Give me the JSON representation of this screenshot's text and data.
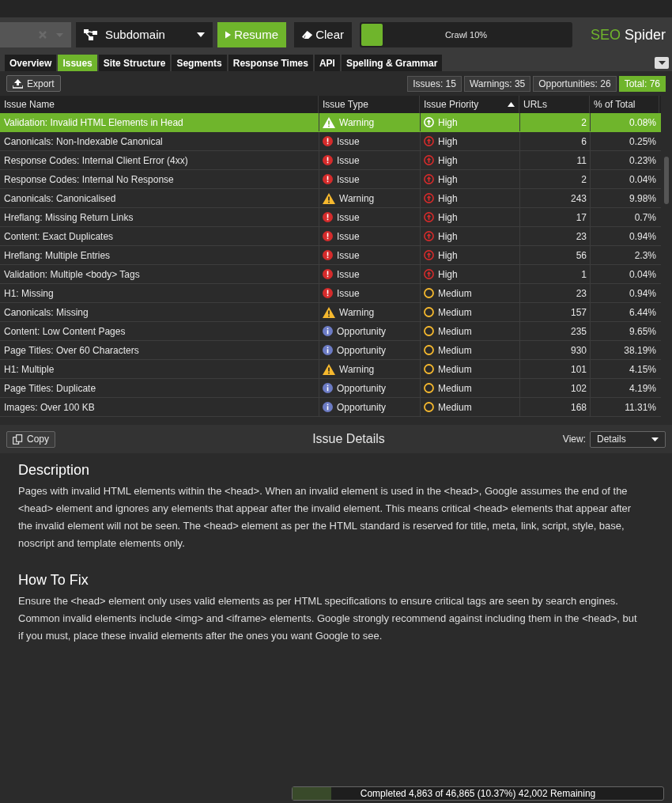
{
  "toolbar": {
    "mode": "Subdomain",
    "resume": "Resume",
    "clear": "Clear",
    "crawl": {
      "label": "Crawl 10%",
      "level": 0.1
    },
    "logo": {
      "part1": "SEO",
      "part2": "Spider"
    }
  },
  "tabs": [
    {
      "label": "Overview",
      "selected": false
    },
    {
      "label": "Issues",
      "selected": true
    },
    {
      "label": "Site Structure",
      "selected": false
    },
    {
      "label": "Segments",
      "selected": false
    },
    {
      "label": "Response Times",
      "selected": false
    },
    {
      "label": "API",
      "selected": false
    },
    {
      "label": "Spelling & Grammar",
      "selected": false
    }
  ],
  "export": "Export",
  "counts": [
    {
      "label": "Issues: 15",
      "selected": false
    },
    {
      "label": "Warnings: 35",
      "selected": false
    },
    {
      "label": "Opportunities: 26",
      "selected": false
    },
    {
      "label": "Total: 76",
      "selected": true
    }
  ],
  "table": {
    "columns": [
      "Issue Name",
      "Issue Type",
      "Issue Priority",
      "URLs",
      "% of Total"
    ],
    "rows": [
      {
        "name": "Validation: Invalid HTML Elements in Head",
        "type": {
          "label": "Warning",
          "kind": "warning"
        },
        "priority": {
          "label": "High",
          "kind": "high"
        },
        "urls": "2",
        "pct": "0.08%",
        "selected": true
      },
      {
        "name": "Canonicals: Non-Indexable Canonical",
        "type": {
          "label": "Issue",
          "kind": "issue"
        },
        "priority": {
          "label": "High",
          "kind": "high"
        },
        "urls": "6",
        "pct": "0.25%",
        "selected": false
      },
      {
        "name": "Response Codes: Internal Client Error (4xx)",
        "type": {
          "label": "Issue",
          "kind": "issue"
        },
        "priority": {
          "label": "High",
          "kind": "high"
        },
        "urls": "11",
        "pct": "0.23%",
        "selected": false
      },
      {
        "name": "Response Codes: Internal No Response",
        "type": {
          "label": "Issue",
          "kind": "issue"
        },
        "priority": {
          "label": "High",
          "kind": "high"
        },
        "urls": "2",
        "pct": "0.04%",
        "selected": false
      },
      {
        "name": "Canonicals: Canonicalised",
        "type": {
          "label": "Warning",
          "kind": "warning"
        },
        "priority": {
          "label": "High",
          "kind": "high"
        },
        "urls": "243",
        "pct": "9.98%",
        "selected": false
      },
      {
        "name": "Hreflang: Missing Return Links",
        "type": {
          "label": "Issue",
          "kind": "issue"
        },
        "priority": {
          "label": "High",
          "kind": "high"
        },
        "urls": "17",
        "pct": "0.7%",
        "selected": false
      },
      {
        "name": "Content: Exact Duplicates",
        "type": {
          "label": "Issue",
          "kind": "issue"
        },
        "priority": {
          "label": "High",
          "kind": "high"
        },
        "urls": "23",
        "pct": "0.94%",
        "selected": false
      },
      {
        "name": "Hreflang: Multiple Entries",
        "type": {
          "label": "Issue",
          "kind": "issue"
        },
        "priority": {
          "label": "High",
          "kind": "high"
        },
        "urls": "56",
        "pct": "2.3%",
        "selected": false
      },
      {
        "name": "Validation: Multiple <body> Tags",
        "type": {
          "label": "Issue",
          "kind": "issue"
        },
        "priority": {
          "label": "High",
          "kind": "high"
        },
        "urls": "1",
        "pct": "0.04%",
        "selected": false
      },
      {
        "name": "H1: Missing",
        "type": {
          "label": "Issue",
          "kind": "issue"
        },
        "priority": {
          "label": "Medium",
          "kind": "medium"
        },
        "urls": "23",
        "pct": "0.94%",
        "selected": false
      },
      {
        "name": "Canonicals: Missing",
        "type": {
          "label": "Warning",
          "kind": "warning"
        },
        "priority": {
          "label": "Medium",
          "kind": "medium"
        },
        "urls": "157",
        "pct": "6.44%",
        "selected": false
      },
      {
        "name": "Content: Low Content Pages",
        "type": {
          "label": "Opportunity",
          "kind": "opportunity"
        },
        "priority": {
          "label": "Medium",
          "kind": "medium"
        },
        "urls": "235",
        "pct": "9.65%",
        "selected": false
      },
      {
        "name": "Page Titles: Over 60 Characters",
        "type": {
          "label": "Opportunity",
          "kind": "opportunity"
        },
        "priority": {
          "label": "Medium",
          "kind": "medium"
        },
        "urls": "930",
        "pct": "38.19%",
        "selected": false
      },
      {
        "name": "H1: Multiple",
        "type": {
          "label": "Warning",
          "kind": "warning"
        },
        "priority": {
          "label": "Medium",
          "kind": "medium"
        },
        "urls": "101",
        "pct": "4.15%",
        "selected": false
      },
      {
        "name": "Page Titles: Duplicate",
        "type": {
          "label": "Opportunity",
          "kind": "opportunity"
        },
        "priority": {
          "label": "Medium",
          "kind": "medium"
        },
        "urls": "102",
        "pct": "4.19%",
        "selected": false
      },
      {
        "name": "Images: Over 100 KB",
        "type": {
          "label": "Opportunity",
          "kind": "opportunity"
        },
        "priority": {
          "label": "Medium",
          "kind": "medium"
        },
        "urls": "168",
        "pct": "11.31%",
        "selected": false
      }
    ]
  },
  "details": {
    "copy": "Copy",
    "title": "Issue Details",
    "view_label": "View:",
    "view_value": "Details",
    "sections": [
      {
        "heading": "Description",
        "text": "Pages with invalid HTML elements within the <head>.  When an invalid element is used in the <head>, Google assumes the end of the <head> element and ignores any elements that appear after the invalid element. This means critical <head> elements that appear after the invalid element will not be seen. The <head> element as per the HTML standard is reserved for title, meta, link, script, style, base, noscript and template elements only."
      },
      {
        "heading": "How To Fix",
        "text": "Ensure the <head> element only uses valid elements as per HTML specifications to ensure critical tags are seen by search engines. Common invalid elements include <img> and <iframe> elements. Google strongly recommend against including them in the <head>, but if you must, place these invalid elements after the ones you want Google to see."
      }
    ]
  },
  "status_bar": {
    "label": "Completed 4,863 of 46,865 (10.37%) 42,002 Remaining",
    "level": 0.1037
  }
}
